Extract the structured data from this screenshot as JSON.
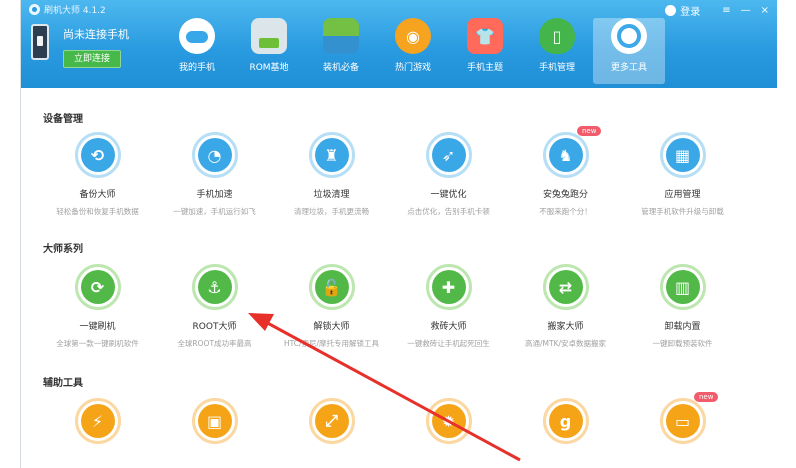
{
  "app": {
    "title": "刷机大师 4.1.2"
  },
  "phone": {
    "status": "尚未连接手机",
    "connect_label": "立即连接"
  },
  "window": {
    "login_label": "登录",
    "min_label": "—",
    "close_label": "×",
    "menu_label": "≡"
  },
  "nav": [
    {
      "label": "我的手机",
      "icon": "cloud-icon"
    },
    {
      "label": "ROM基地",
      "icon": "rom-icon"
    },
    {
      "label": "装机必备",
      "icon": "apps-icon"
    },
    {
      "label": "热门游戏",
      "icon": "games-icon"
    },
    {
      "label": "手机主题",
      "icon": "theme-icon"
    },
    {
      "label": "手机管理",
      "icon": "manage-icon"
    },
    {
      "label": "更多工具",
      "icon": "tools-icon",
      "active": true
    }
  ],
  "sections": {
    "device": {
      "title": "设备管理",
      "items": [
        {
          "name": "备份大师",
          "desc": "轻松备份和恢复手机数据",
          "glyph": "⟲"
        },
        {
          "name": "手机加速",
          "desc": "一键加速，手机运行如飞",
          "glyph": "◔"
        },
        {
          "name": "垃圾清理",
          "desc": "清理垃圾，手机更流畅",
          "glyph": "♜"
        },
        {
          "name": "一键优化",
          "desc": "点击优化，告别手机卡顿",
          "glyph": "➶"
        },
        {
          "name": "安兔兔跑分",
          "desc": "不服来跑个分！",
          "glyph": "♞",
          "badge": "new"
        },
        {
          "name": "应用管理",
          "desc": "管理手机软件升级与卸载",
          "glyph": "▦"
        }
      ]
    },
    "master": {
      "title": "大师系列",
      "items": [
        {
          "name": "一键刷机",
          "desc": "全球第一款一键刷机软件",
          "glyph": "⟳"
        },
        {
          "name": "ROOT大师",
          "desc": "全球ROOT成功率最高",
          "glyph": "⚓"
        },
        {
          "name": "解锁大师",
          "desc": "HTC/索尼/摩托专用解锁工具",
          "glyph": "🔓"
        },
        {
          "name": "救砖大师",
          "desc": "一键救砖让手机起死回生",
          "glyph": "✚"
        },
        {
          "name": "搬家大师",
          "desc": "高通/MTK/安卓数据搬家",
          "glyph": "⇄"
        },
        {
          "name": "卸载内置",
          "desc": "一键卸载预装软件",
          "glyph": "▥"
        }
      ]
    },
    "aux": {
      "title": "辅助工具",
      "items": [
        {
          "glyph": "⚡"
        },
        {
          "glyph": "▣"
        },
        {
          "glyph": "⤢"
        },
        {
          "glyph": "✹"
        },
        {
          "glyph": "g"
        },
        {
          "glyph": "▭",
          "badge": "new"
        }
      ]
    }
  }
}
